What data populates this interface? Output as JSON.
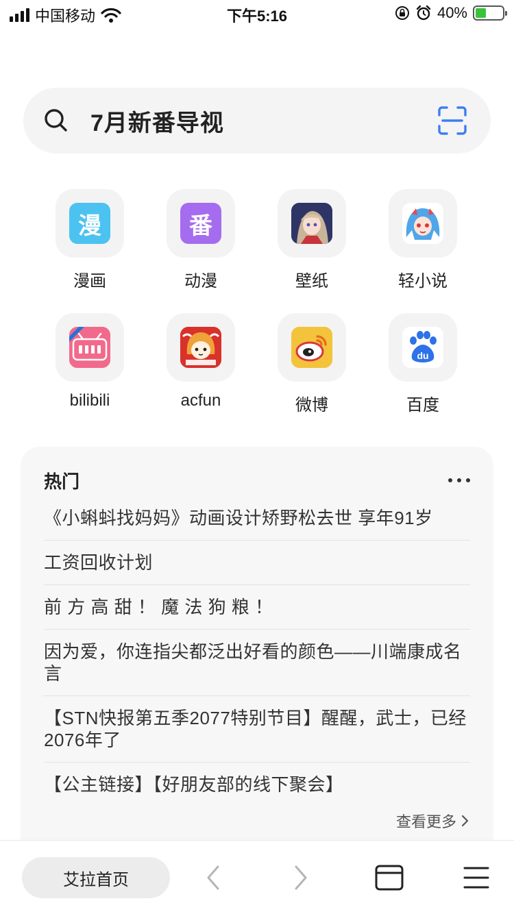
{
  "status_bar": {
    "carrier": "中国移动",
    "time": "下午5:16",
    "battery_percent": "40%",
    "battery_level": 0.4
  },
  "search": {
    "text": "7月新番导视",
    "icon": "search-icon",
    "scan_icon": "scan-icon",
    "accent_color": "#3d7ef0"
  },
  "shortcuts": [
    {
      "label": "漫画",
      "icon": "漫",
      "color": "#4cc2f0"
    },
    {
      "label": "动漫",
      "icon": "番",
      "color": "#a56cf0"
    },
    {
      "label": "壁纸",
      "icon": "anime-girl-wallpaper-icon",
      "color": "#3b3f7a"
    },
    {
      "label": "轻小说",
      "icon": "anime-girl-novel-icon",
      "color": "#4fa6e8"
    },
    {
      "label": "bilibili",
      "icon": "bilibili-logo",
      "color": "#f16a8c"
    },
    {
      "label": "acfun",
      "icon": "acfun-logo",
      "color": "#d8322a"
    },
    {
      "label": "微博",
      "icon": "weibo-logo",
      "color": "#f3c33b"
    },
    {
      "label": "百度",
      "icon": "baidu-logo",
      "color": "#2d72e8"
    }
  ],
  "hot": {
    "title": "热门",
    "items": [
      "《小蝌蚪找妈妈》动画设计矫野松去世 享年91岁",
      "工资回收计划",
      "前 方 高 甜 ！ 魔 法 狗 粮 ！",
      "因为爱，你连指尖都泛出好看的颜色——川端康成名言",
      "【STN快报第五季2077特别节目】醒醒，武士，已经2076年了",
      "【公主链接】【好朋友部的线下聚会】"
    ],
    "see_more": "查看更多"
  },
  "bottom_bar": {
    "home_label": "艾拉首页"
  }
}
